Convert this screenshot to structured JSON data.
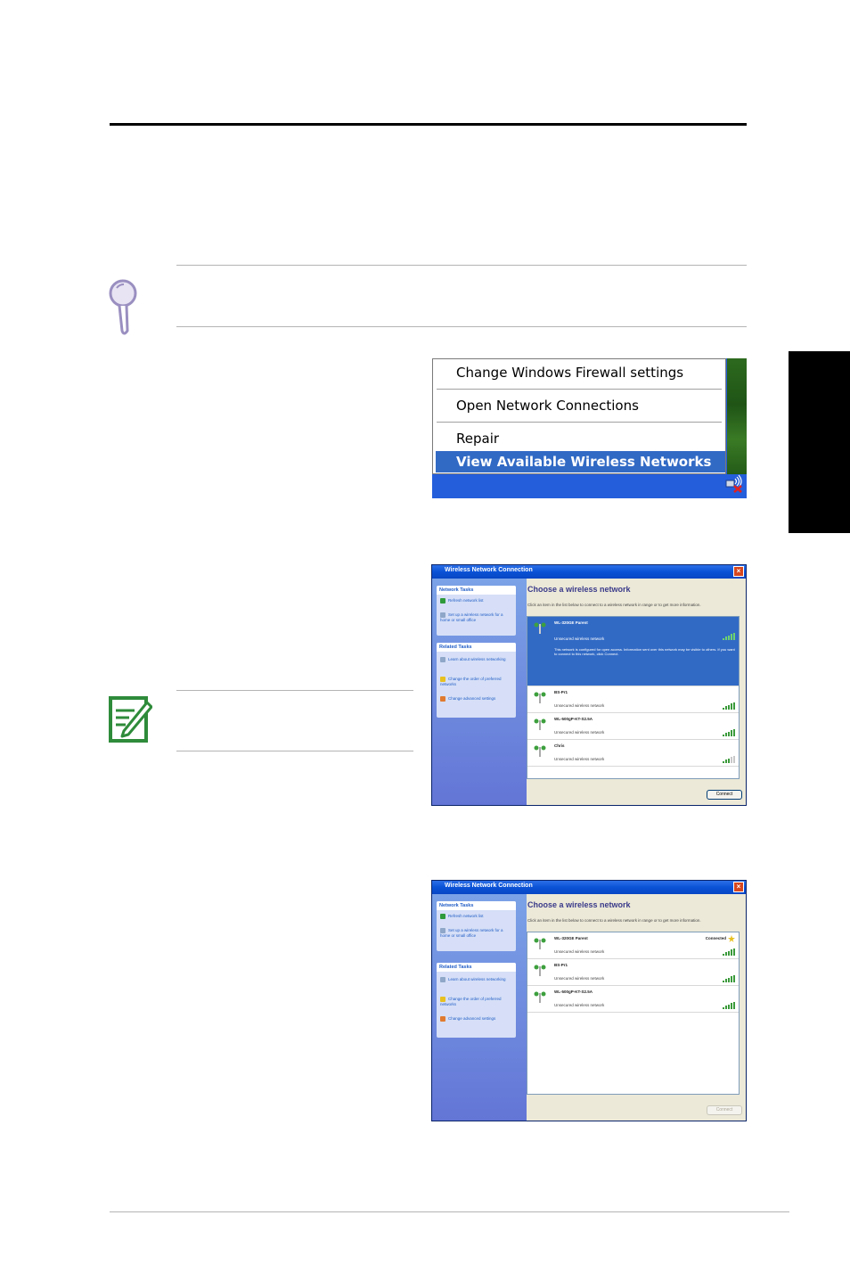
{
  "context_menu": {
    "items": [
      "Change Windows Firewall settings",
      "Open Network Connections",
      "Repair"
    ],
    "highlighted": "View Available Wireless Networks"
  },
  "dialog1": {
    "title": "Wireless Network Connection",
    "heading": "Choose a wireless network",
    "subtext": "Click an item in the list below to connect to a wireless network in range or to get more information.",
    "network_tasks_header": "Network Tasks",
    "network_tasks": [
      "Refresh network list",
      "Set up a wireless network for a home or small office"
    ],
    "related_tasks_header": "Related Tasks",
    "related_tasks": [
      "Learn about wireless networking",
      "Change the order of preferred networks",
      "Change advanced settings"
    ],
    "networks": [
      {
        "name": "WL-320GE Parent",
        "desc": "Unsecured wireless network",
        "note": "This network is configured for open access. Information sent over this network may be visible to others. If you want to connect to this network, click Connect."
      },
      {
        "name": "BS-Pr1",
        "desc": "Unsecured wireless network"
      },
      {
        "name": "WL-500gP-KT-S2.5A",
        "desc": "Unsecured wireless network"
      },
      {
        "name": "Chris",
        "desc": "Unsecured wireless network"
      }
    ],
    "button": "Connect"
  },
  "dialog2": {
    "title": "Wireless Network Connection",
    "heading": "Choose a wireless network",
    "subtext": "Click an item in the list below to connect to a wireless network in range or to get more information.",
    "network_tasks_header": "Network Tasks",
    "network_tasks": [
      "Refresh network list",
      "Set up a wireless network for a home or small office"
    ],
    "related_tasks_header": "Related Tasks",
    "related_tasks": [
      "Learn about wireless networking",
      "Change the order of preferred networks",
      "Change advanced settings"
    ],
    "networks": [
      {
        "name": "WL-320GE Parent",
        "desc": "Unsecured wireless network",
        "status": "Connected"
      },
      {
        "name": "BS-Pr1",
        "desc": "Unsecured wireless network"
      },
      {
        "name": "WL-500gP-KT-S2.5A",
        "desc": "Unsecured wireless network"
      }
    ],
    "button": "Connect"
  },
  "colors": {
    "xp_blue": "#245edb",
    "menu_highlight": "#316ac5",
    "hint_icon": "#9a8fc0",
    "note_icon": "#2e8b3a"
  },
  "icons": [
    "magnifier-hint-icon",
    "note-pencil-icon",
    "wireless-tray-icon",
    "antenna-icon",
    "signal-bars-icon"
  ]
}
